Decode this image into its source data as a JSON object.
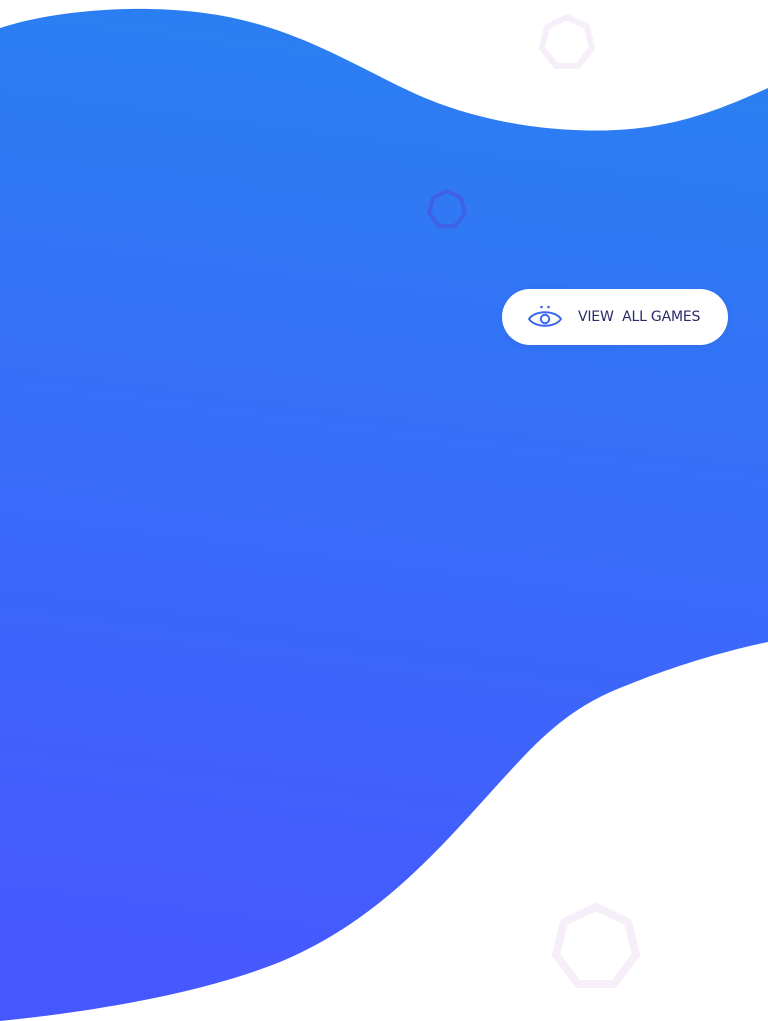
{
  "colors": {
    "blob_gradient_top": "#2a80f2",
    "blob_gradient_bottom": "#4757ff",
    "button_background": "#ffffff",
    "button_text": "#2b2a6b",
    "icon_accent": "#3b66ef",
    "deco_faint": "#f6eef8",
    "deco_mid": "#3f61e6"
  },
  "cta": {
    "icon": "eye-icon",
    "label": "VIEW  ALL GAMES"
  },
  "decorations": [
    "heptagon-outline-icon",
    "heptagon-outline-icon",
    "heptagon-outline-icon"
  ]
}
